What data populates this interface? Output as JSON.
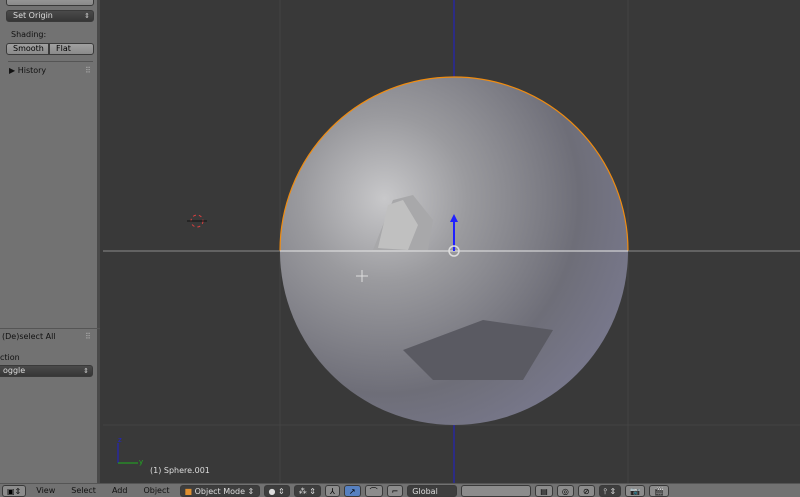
{
  "left_panel": {
    "set_origin": "Set Origin",
    "shading_label": "Shading:",
    "smooth": "Smooth",
    "flat": "Flat",
    "history": "History",
    "operator_title": "(De)select All",
    "action_label": "ction",
    "action_value": "oggle"
  },
  "viewport": {
    "object_info": "(1) Sphere.001",
    "axis_z": "z",
    "axis_y": "y"
  },
  "toolbar": {
    "menus": [
      "View",
      "Select",
      "Add",
      "Object"
    ],
    "mode": "Object Mode",
    "orientation": "Global"
  },
  "colors": {
    "selection": "#f08c10",
    "z_axis": "#2020d0",
    "y_axis": "#20b020"
  }
}
